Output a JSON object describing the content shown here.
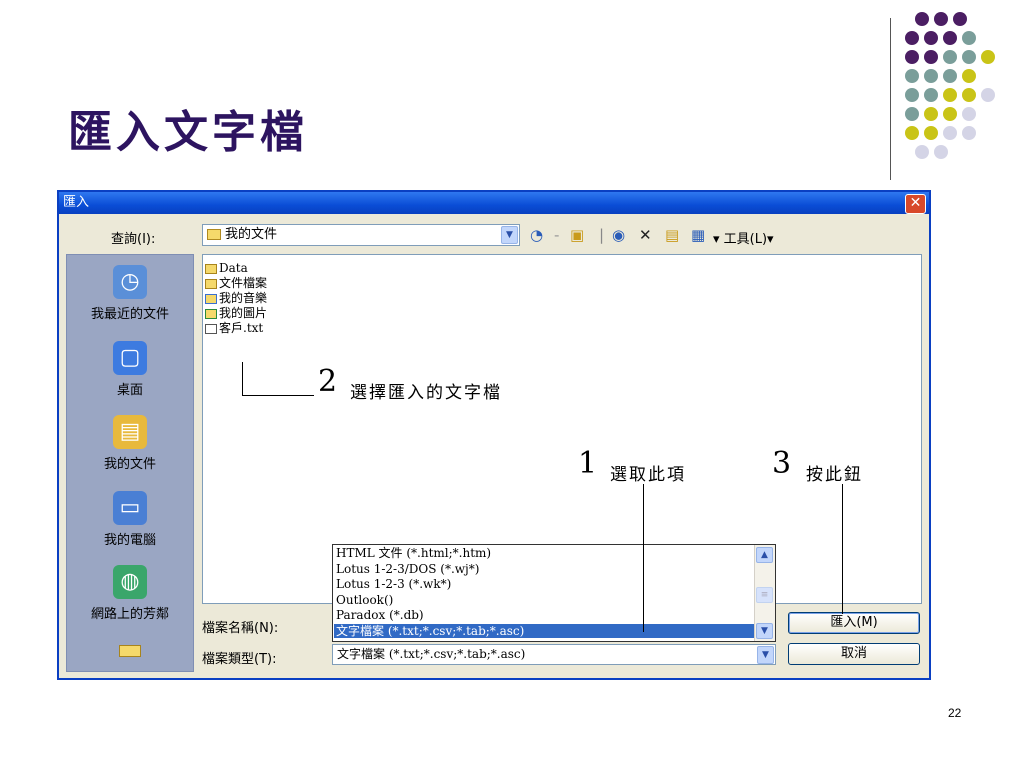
{
  "slide": {
    "title": "匯入文字檔",
    "page_number": "22"
  },
  "dialog": {
    "title": "匯入",
    "close_symbol": "✕",
    "look_in_label": "查詢(I):",
    "look_in_value": "我的文件",
    "tools_label": "▾ 工具(L)▾",
    "places": [
      {
        "label": "我最近的文件",
        "icon": "recent-documents-icon"
      },
      {
        "label": "桌面",
        "icon": "desktop-icon"
      },
      {
        "label": "我的文件",
        "icon": "my-documents-icon"
      },
      {
        "label": "我的電腦",
        "icon": "my-computer-icon"
      },
      {
        "label": "網路上的芳鄰",
        "icon": "network-places-icon"
      }
    ],
    "files": [
      {
        "name": "Data",
        "icon": "folder-icon"
      },
      {
        "name": "文件檔案",
        "icon": "folder-icon"
      },
      {
        "name": "我的音樂",
        "icon": "music-folder-icon"
      },
      {
        "name": "我的圖片",
        "icon": "pictures-folder-icon"
      },
      {
        "name": "客戶.txt",
        "icon": "text-file-icon"
      }
    ],
    "file_name_label": "檔案名稱(N):",
    "file_type_label": "檔案類型(T):",
    "file_type_value": "文字檔案 (*.txt;*.csv;*.tab;*.asc)",
    "file_type_options": [
      "HTML 文件 (*.html;*.htm)",
      "Lotus 1-2-3/DOS (*.wj*)",
      "Lotus 1-2-3 (*.wk*)",
      "Outlook()",
      "Paradox (*.db)",
      "文字檔案 (*.txt;*.csv;*.tab;*.asc)"
    ],
    "selected_option_index": 5,
    "import_button": "匯入(M)",
    "cancel_button": "取消"
  },
  "annotations": {
    "step1_num": "1",
    "step1_text": "選取此項",
    "step2_num": "2",
    "step2_text": "選擇匯入的文字檔",
    "step3_num": "3",
    "step3_text": "按此鈕"
  },
  "colors": {
    "title": "#2d1460",
    "dialog_frame": "#0a3fc2",
    "selection": "#316ac5",
    "dot_purple": "#4b1e63",
    "dot_teal": "#7a9e9a",
    "dot_yellow": "#c9c417",
    "dot_lavender": "#d4d4e6"
  }
}
